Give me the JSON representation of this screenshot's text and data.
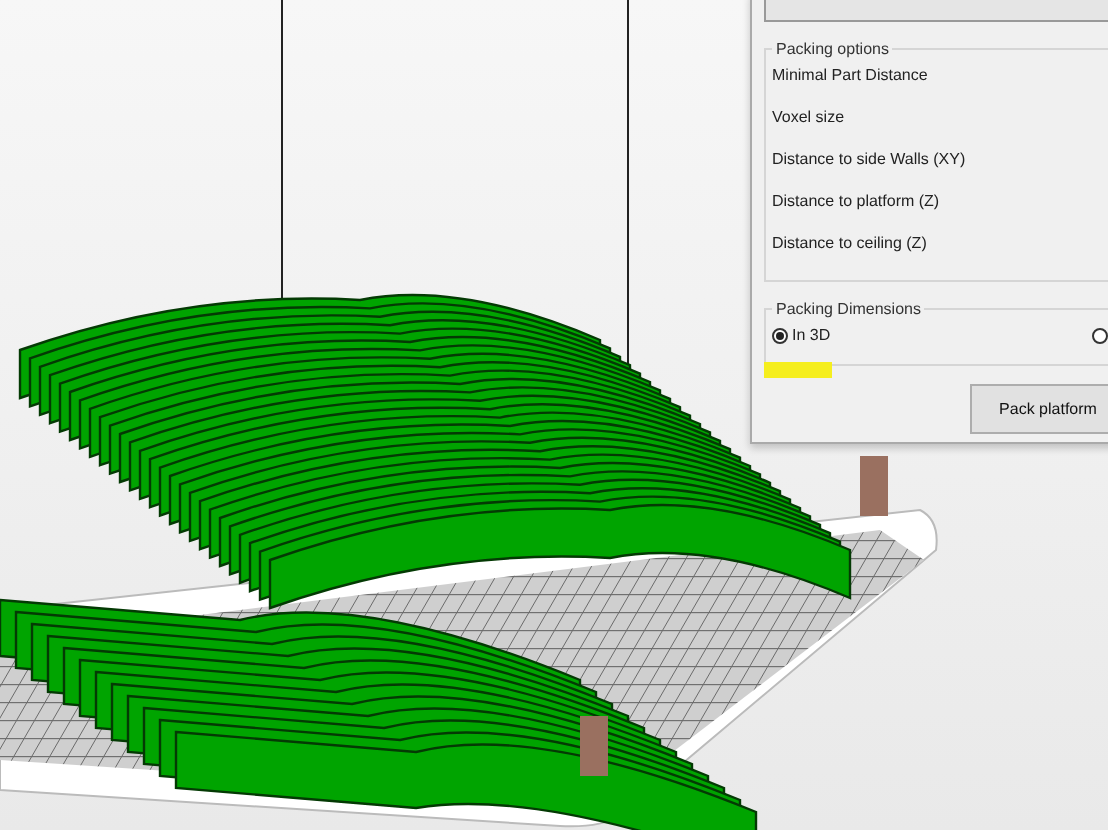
{
  "packing_options": {
    "title": "Packing options",
    "rows": [
      "Minimal Part Distance",
      "Voxel size",
      "Distance to side Walls (XY)",
      "Distance to platform (Z)",
      "Distance to ceiling (Z)"
    ]
  },
  "packing_dimensions": {
    "title": "Packing Dimensions",
    "options": [
      {
        "label": "In 3D",
        "selected": true
      },
      {
        "selected": false
      }
    ]
  },
  "buttons": [
    "Pack platform"
  ]
}
